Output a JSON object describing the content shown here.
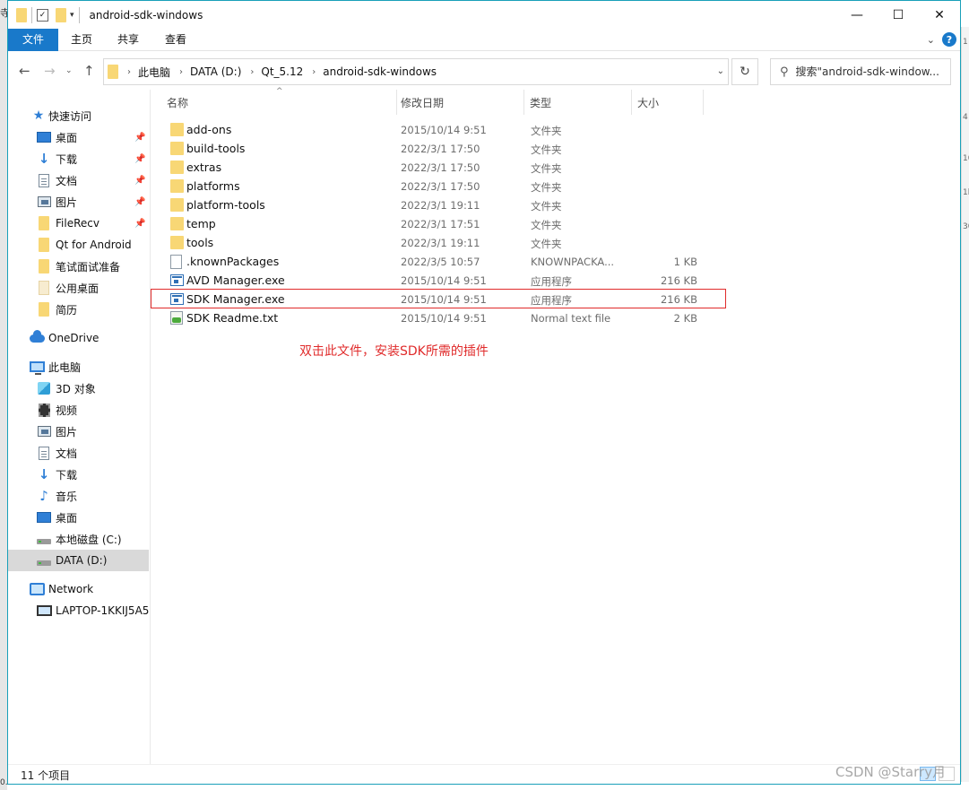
{
  "window": {
    "title": "android-sdk-windows",
    "controls": {
      "minimize": "—",
      "maximize": "☐",
      "close": "✕"
    }
  },
  "ribbon": {
    "tabs": [
      "文件",
      "主页",
      "共享",
      "查看"
    ],
    "help": "?"
  },
  "address": {
    "crumbs": [
      "此电脑",
      "DATA (D:)",
      "Qt_5.12",
      "android-sdk-windows"
    ],
    "search_placeholder": "搜索\"android-sdk-window..."
  },
  "sidebar": {
    "quick_access": "快速访问",
    "pinned": [
      {
        "label": "桌面",
        "icon": "desktop-icon"
      },
      {
        "label": "下载",
        "icon": "download-icon"
      },
      {
        "label": "文档",
        "icon": "document-icon"
      },
      {
        "label": "图片",
        "icon": "picture-icon"
      },
      {
        "label": "FileRecv",
        "icon": "folder-icon"
      }
    ],
    "recent": [
      {
        "label": "Qt for Android",
        "icon": "folder-icon"
      },
      {
        "label": "笔试面试准备",
        "icon": "folder-icon"
      },
      {
        "label": "公用桌面",
        "icon": "folder-icon"
      },
      {
        "label": "简历",
        "icon": "folder-icon"
      }
    ],
    "onedrive": "OneDrive",
    "this_pc": "此电脑",
    "pc_items": [
      {
        "label": "3D 对象",
        "icon": "3d-objects-icon"
      },
      {
        "label": "视频",
        "icon": "video-icon"
      },
      {
        "label": "图片",
        "icon": "picture-icon"
      },
      {
        "label": "文档",
        "icon": "document-icon"
      },
      {
        "label": "下载",
        "icon": "download-icon"
      },
      {
        "label": "音乐",
        "icon": "music-icon"
      },
      {
        "label": "桌面",
        "icon": "desktop-icon"
      },
      {
        "label": "本地磁盘 (C:)",
        "icon": "drive-icon"
      },
      {
        "label": "DATA (D:)",
        "icon": "drive-icon",
        "selected": true
      }
    ],
    "network": "Network",
    "network_items": [
      {
        "label": "LAPTOP-1KKIJ5A5",
        "icon": "computer-icon"
      }
    ]
  },
  "columns": {
    "name": "名称",
    "date": "修改日期",
    "type": "类型",
    "size": "大小"
  },
  "files": [
    {
      "name": "add-ons",
      "date": "2015/10/14 9:51",
      "type": "文件夹",
      "size": "",
      "kind": "folder"
    },
    {
      "name": "build-tools",
      "date": "2022/3/1 17:50",
      "type": "文件夹",
      "size": "",
      "kind": "folder"
    },
    {
      "name": "extras",
      "date": "2022/3/1 17:50",
      "type": "文件夹",
      "size": "",
      "kind": "folder"
    },
    {
      "name": "platforms",
      "date": "2022/3/1 17:50",
      "type": "文件夹",
      "size": "",
      "kind": "folder"
    },
    {
      "name": "platform-tools",
      "date": "2022/3/1 19:11",
      "type": "文件夹",
      "size": "",
      "kind": "folder"
    },
    {
      "name": "temp",
      "date": "2022/3/1 17:51",
      "type": "文件夹",
      "size": "",
      "kind": "folder"
    },
    {
      "name": "tools",
      "date": "2022/3/1 19:11",
      "type": "文件夹",
      "size": "",
      "kind": "folder"
    },
    {
      "name": ".knownPackages",
      "date": "2022/3/5 10:57",
      "type": "KNOWNPACKA...",
      "size": "1 KB",
      "kind": "file"
    },
    {
      "name": "AVD Manager.exe",
      "date": "2015/10/14 9:51",
      "type": "应用程序",
      "size": "216 KB",
      "kind": "exe"
    },
    {
      "name": "SDK Manager.exe",
      "date": "2015/10/14 9:51",
      "type": "应用程序",
      "size": "216 KB",
      "kind": "exe"
    },
    {
      "name": "SDK Readme.txt",
      "date": "2015/10/14 9:51",
      "type": "Normal text file",
      "size": "2 KB",
      "kind": "txt"
    }
  ],
  "annotation": "双击此文件，安装SDK所需的插件",
  "status": {
    "count": "11 个项目"
  },
  "watermark": "CSDN @Starry月",
  "edge_fragments": {
    "left_top": "寺",
    "left_bottom": "0.02",
    "right": [
      "1",
      "4",
      "10",
      "1b",
      "30"
    ]
  },
  "colors": {
    "accent": "#1979ca",
    "annotation": "#e02b2b",
    "frame": "#19a0b9"
  }
}
